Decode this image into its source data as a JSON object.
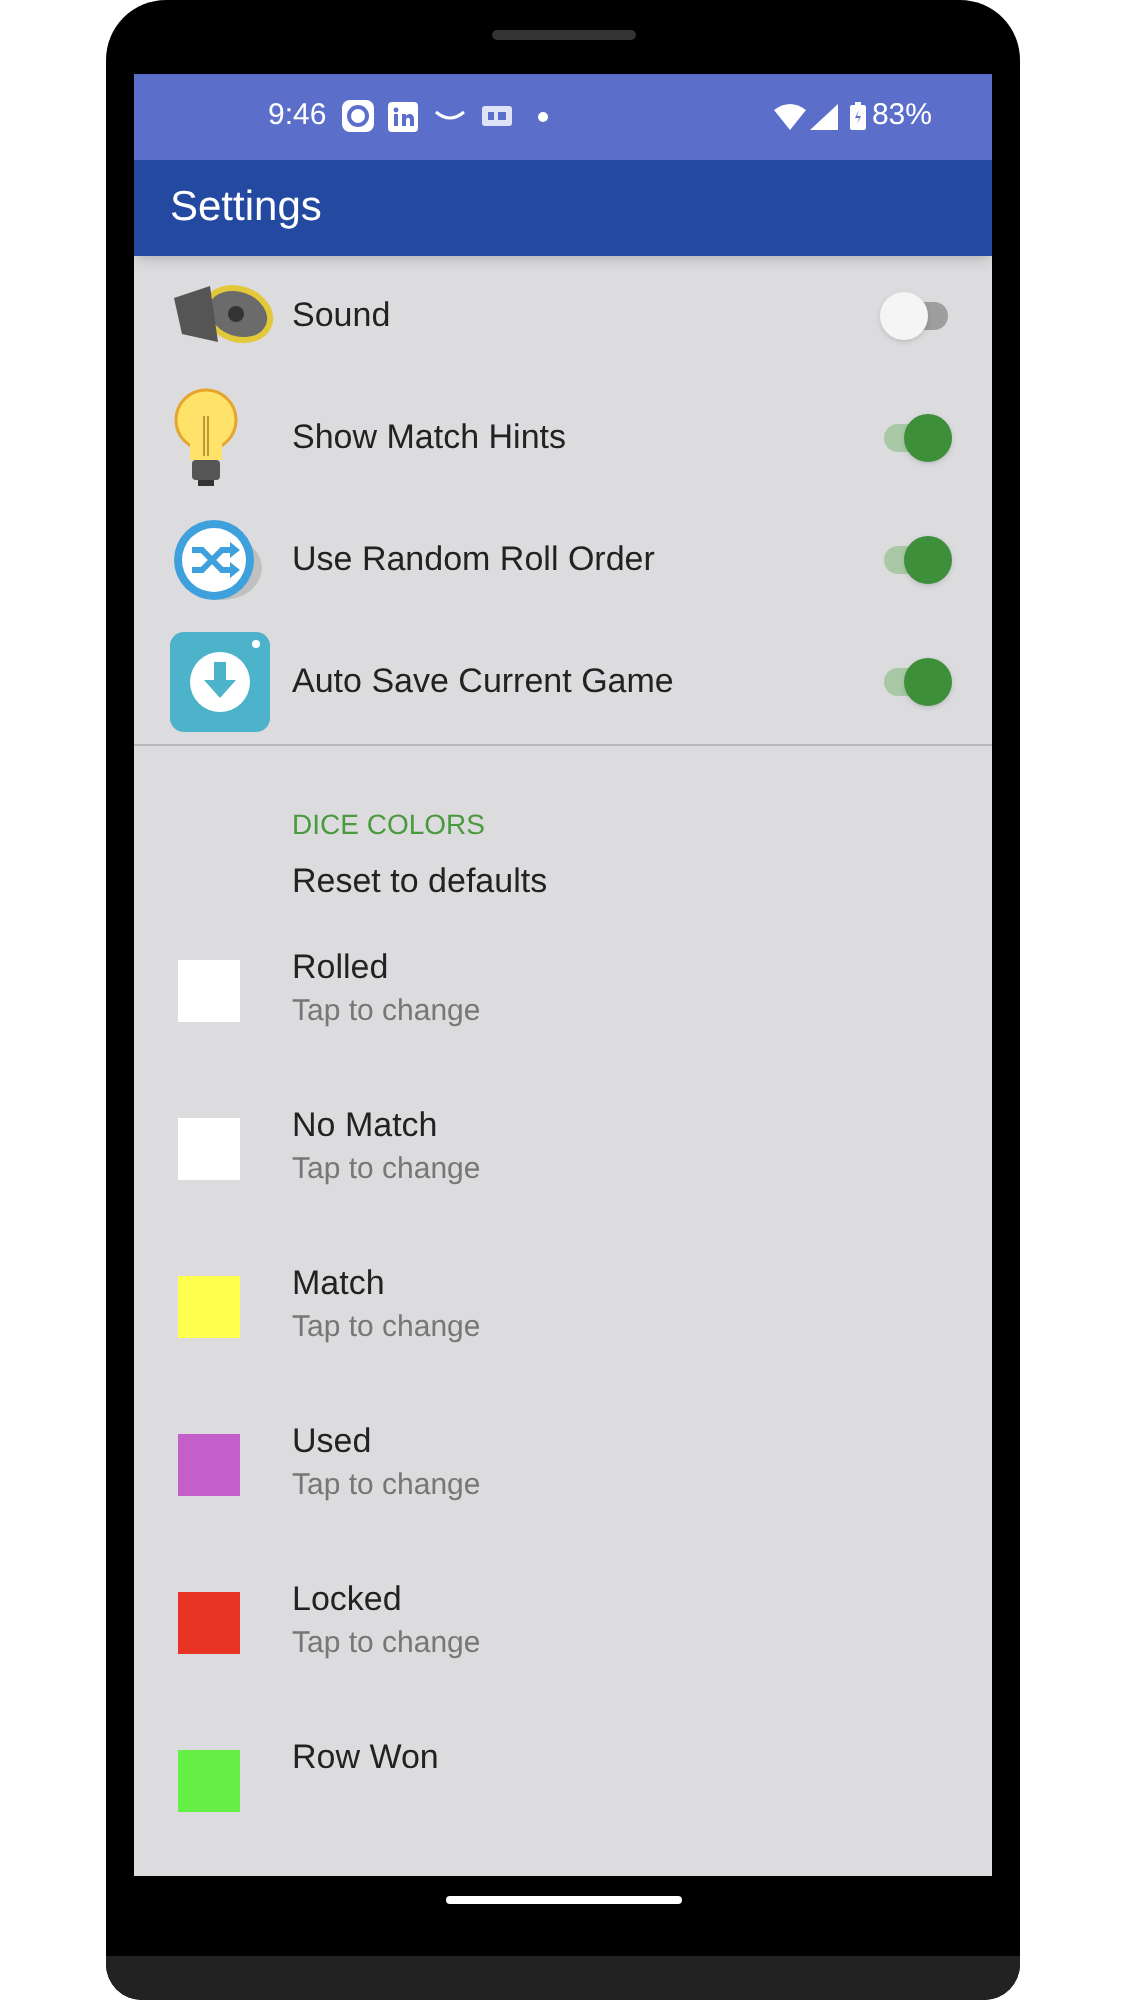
{
  "status_bar": {
    "time": "9:46",
    "battery": "83%"
  },
  "app_bar": {
    "title": "Settings"
  },
  "toggles": [
    {
      "kind": "speaker",
      "label": "Sound",
      "on": false
    },
    {
      "kind": "bulb",
      "label": "Show Match Hints",
      "on": true
    },
    {
      "kind": "shuffle",
      "label": "Use Random Roll Order",
      "on": true
    },
    {
      "kind": "download",
      "label": "Auto Save Current Game",
      "on": true
    }
  ],
  "section_header": "DICE COLORS",
  "reset_action": "Reset to defaults",
  "dice_colors": [
    {
      "title": "Rolled",
      "subtitle": "Tap to change",
      "color": "#ffffff"
    },
    {
      "title": "No Match",
      "subtitle": "Tap to change",
      "color": "#ffffff"
    },
    {
      "title": "Match",
      "subtitle": "Tap to change",
      "color": "#ffff4d"
    },
    {
      "title": "Used",
      "subtitle": "Tap to change",
      "color": "#c45ec8"
    },
    {
      "title": "Locked",
      "subtitle": "Tap to change",
      "color": "#e83425"
    },
    {
      "title": "Row Won",
      "color": "#66f045"
    }
  ]
}
